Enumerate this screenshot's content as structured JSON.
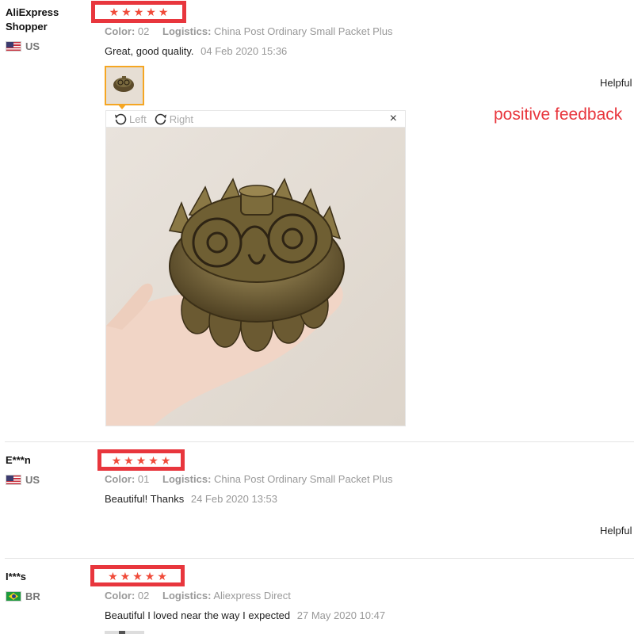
{
  "annotation": "positive feedback",
  "reviews": [
    {
      "user": "AliExpress Shopper",
      "country": "US",
      "rating": 5,
      "color_label": "Color:",
      "color_value": "02",
      "logistics_label": "Logistics:",
      "logistics_value": "China Post Ordinary Small Packet Plus",
      "comment": "Great, good quality.",
      "date": "04 Feb 2020 15:36",
      "helpful": "Helpful"
    },
    {
      "user": "E***n",
      "country": "US",
      "rating": 5,
      "color_label": "Color:",
      "color_value": "01",
      "logistics_label": "Logistics:",
      "logistics_value": "China Post Ordinary Small Packet Plus",
      "comment": "Beautiful! Thanks",
      "date": "24 Feb 2020 13:53",
      "helpful": "Helpful"
    },
    {
      "user": "I***s",
      "country": "BR",
      "rating": 5,
      "color_label": "Color:",
      "color_value": "02",
      "logistics_label": "Logistics:",
      "logistics_value": "Aliexpress Direct",
      "comment": "Beautiful I loved near the way I expected",
      "date": "27 May 2020 10:47"
    }
  ],
  "image_viewer": {
    "rotate_left": "Left",
    "rotate_right": "Right",
    "close": "×"
  },
  "colors": {
    "star": "#f04b3a",
    "highlight_box": "#e8363d",
    "thumb_border": "#f5a623"
  }
}
